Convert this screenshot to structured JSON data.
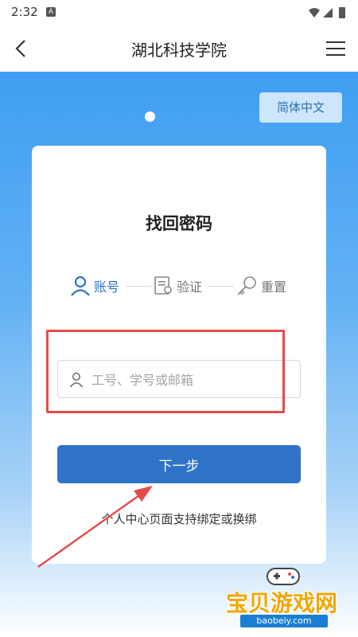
{
  "status_bar": {
    "time": "2:32",
    "notif_letter": "A"
  },
  "app_bar": {
    "title": "湖北科技学院"
  },
  "language_button": "简体中文",
  "card": {
    "title": "找回密码",
    "steps": [
      {
        "label": "账号",
        "icon": "user-icon",
        "active": true
      },
      {
        "label": "验证",
        "icon": "verify-document-icon",
        "active": false
      },
      {
        "label": "重置",
        "icon": "key-icon",
        "active": false
      }
    ],
    "input": {
      "value": "",
      "placeholder": "工号、学号或邮箱",
      "icon": "user-icon"
    },
    "next_button": "下一步",
    "tip": "个人中心页面支持绑定或换绑"
  },
  "watermark": {
    "name": "宝贝游戏网",
    "url": "baobeiy.com"
  },
  "colors": {
    "primary": "#2f73c9",
    "highlight": "#e84a4a",
    "hero_top": "#3f9ef2"
  }
}
